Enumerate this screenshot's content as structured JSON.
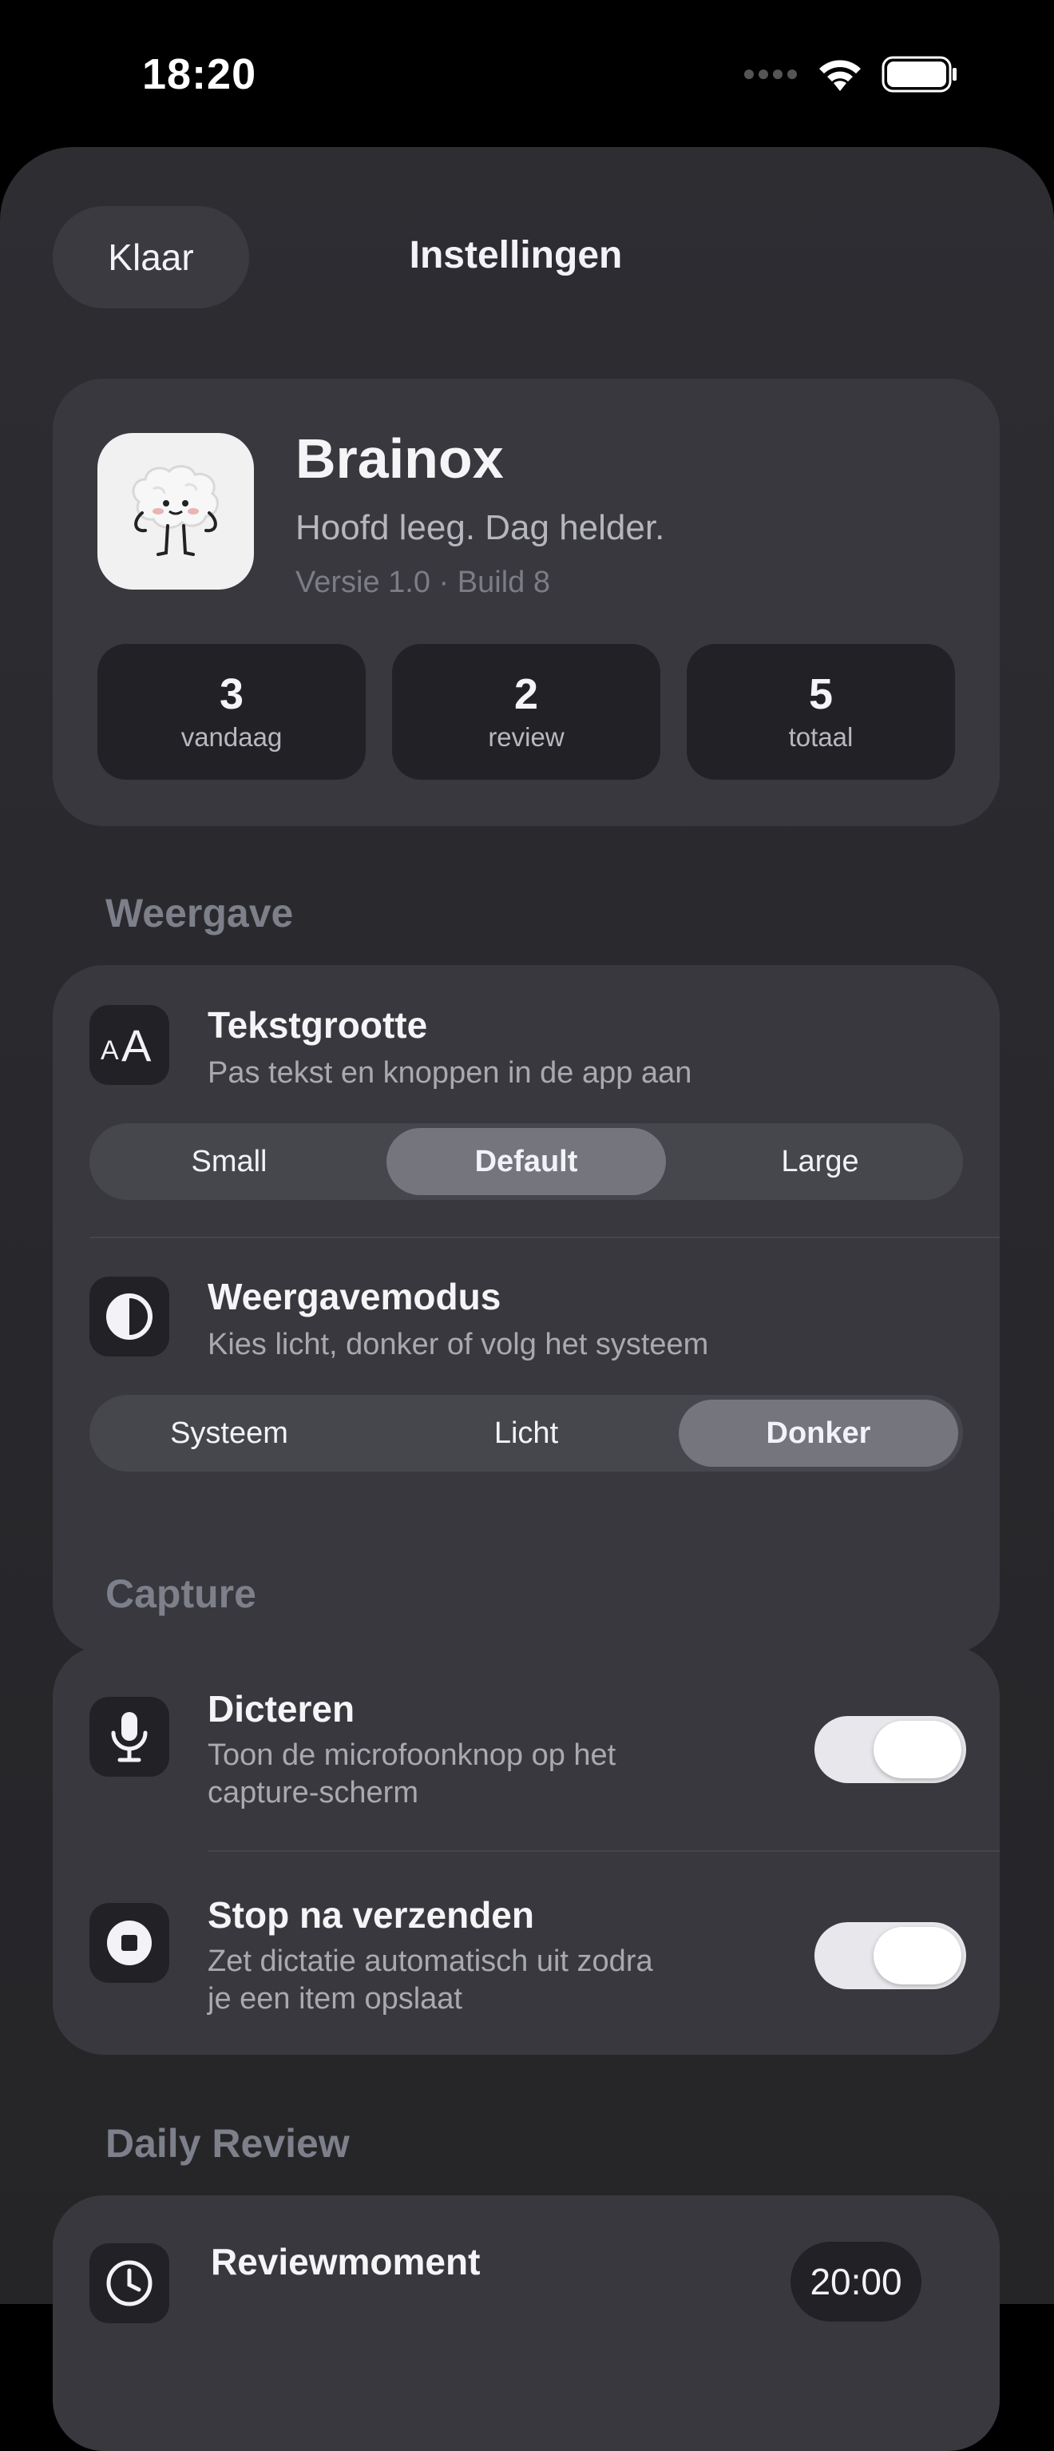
{
  "status_bar": {
    "time": "18:20"
  },
  "nav": {
    "done_label": "Klaar",
    "title": "Instellingen"
  },
  "app": {
    "name": "Brainox",
    "tagline": "Hoofd leeg. Dag helder.",
    "version": "Versie 1.0 · Build 8"
  },
  "stats": [
    {
      "value": "3",
      "label": "vandaag"
    },
    {
      "value": "2",
      "label": "review"
    },
    {
      "value": "5",
      "label": "totaal"
    }
  ],
  "sections": {
    "display": {
      "header": "Weergave",
      "text_size": {
        "title": "Tekstgrootte",
        "subtitle": "Pas tekst en knoppen in de app aan",
        "options": [
          "Small",
          "Default",
          "Large"
        ],
        "selected": "Default"
      },
      "appearance": {
        "title": "Weergavemodus",
        "subtitle": "Kies licht, donker of volg het systeem",
        "options": [
          "Systeem",
          "Licht",
          "Donker"
        ],
        "selected": "Donker"
      }
    },
    "capture": {
      "header": "Capture",
      "dictation": {
        "title": "Dicteren",
        "subtitle_line1": "Toon de microfoonknop op het",
        "subtitle_line2": "capture-scherm",
        "enabled": true
      },
      "stop_after_send": {
        "title": "Stop na verzenden",
        "subtitle_line1": "Zet dictatie automatisch uit zodra",
        "subtitle_line2": "je een item opslaat",
        "enabled": true
      }
    },
    "daily_review": {
      "header": "Daily Review",
      "review_moment": {
        "title": "Reviewmoment",
        "time": "20:00"
      }
    }
  },
  "colors": {
    "background": "#000000",
    "sheet": "#2b2b30",
    "card": "#38383e",
    "section_header": "#7d7f8a",
    "segment_active": "#75757e"
  },
  "icons": {
    "wifi": "wifi-icon",
    "battery": "battery-icon",
    "signal": "cellular-signal-icon",
    "text_size": "text-size-icon",
    "appearance": "half-circle-contrast-icon",
    "dictation": "microphone-icon",
    "stop": "stop-circle-icon",
    "review": "clock-icon"
  }
}
